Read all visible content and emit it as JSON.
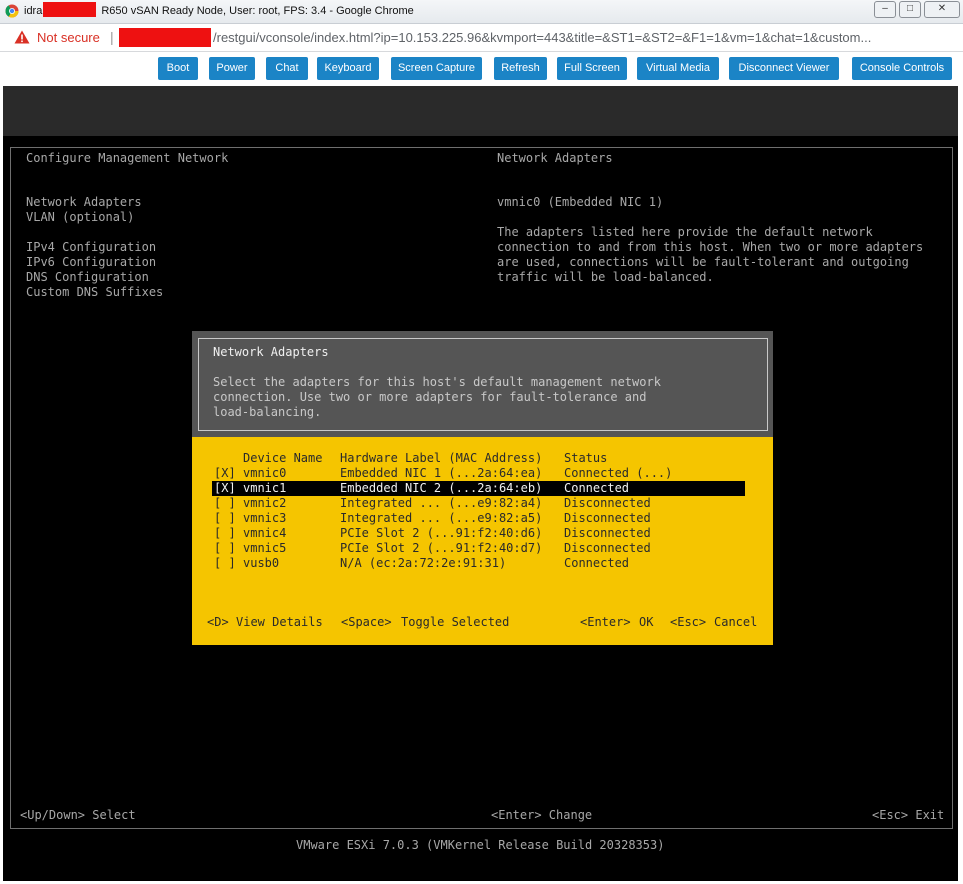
{
  "window": {
    "title_prefix": "idra",
    "title_rest": "R650 vSAN Ready Node, User: root, FPS: 3.4 - Google Chrome",
    "controls": [
      "–",
      "□",
      "✕"
    ]
  },
  "addressbar": {
    "security_label": "Not secure",
    "url": "/restgui/vconsole/index.html?ip=10.153.225.96&kvmport=443&title=&ST1=&ST2=&F1=1&vm=1&chat=1&custom..."
  },
  "toolbar": {
    "buttons": [
      "Boot",
      "Power",
      "Chat",
      "Keyboard",
      "Screen Capture",
      "Refresh",
      "Full Screen",
      "Virtual Media",
      "Disconnect Viewer",
      "Console Controls"
    ]
  },
  "dcui": {
    "left_title": "Configure Management Network",
    "right_title": "Network Adapters",
    "menu": [
      "Network Adapters",
      "VLAN (optional)",
      "IPv4 Configuration",
      "IPv6 Configuration",
      "DNS Configuration",
      "Custom DNS Suffixes"
    ],
    "selected_adapter": "vmnic0 (Embedded NIC 1)",
    "description": [
      "The adapters listed here provide the default network",
      "connection to and from this host. When two or more adapters",
      "are used, connections will be fault-tolerant and outgoing",
      "traffic will be load-balanced."
    ],
    "footer_left": "<Up/Down> Select",
    "footer_center": "<Enter> Change",
    "footer_right": "<Esc> Exit",
    "version": "VMware ESXi 7.0.3 (VMKernel Release Build 20328353)"
  },
  "dialog": {
    "title": "Network Adapters",
    "intro": [
      "Select the adapters for this host's default management network",
      "connection. Use two or more adapters for fault-tolerance and",
      "load-balancing."
    ],
    "columns": {
      "device": "Device Name",
      "hardware": "Hardware Label (MAC Address)",
      "status": "Status"
    },
    "rows": [
      {
        "check": "[X]",
        "device": "vmnic0",
        "hardware": "Embedded NIC 1 (...2a:64:ea)",
        "status": "Connected (...)"
      },
      {
        "check": "[X]",
        "device": "vmnic1",
        "hardware": "Embedded NIC 2 (...2a:64:eb)",
        "status": "Connected"
      },
      {
        "check": "[ ]",
        "device": "vmnic2",
        "hardware": "Integrated ... (...e9:82:a4)",
        "status": "Disconnected"
      },
      {
        "check": "[ ]",
        "device": "vmnic3",
        "hardware": "Integrated ... (...e9:82:a5)",
        "status": "Disconnected"
      },
      {
        "check": "[ ]",
        "device": "vmnic4",
        "hardware": "PCIe Slot 2 (...91:f2:40:d6)",
        "status": "Disconnected"
      },
      {
        "check": "[ ]",
        "device": "vmnic5",
        "hardware": "PCIe Slot 2 (...91:f2:40:d7)",
        "status": "Disconnected"
      },
      {
        "check": "[ ]",
        "device": "vusb0",
        "hardware": "N/A (ec:2a:72:2e:91:31)",
        "status": "Connected"
      }
    ],
    "actions": {
      "details_key": "<D>",
      "details_label": "View Details",
      "toggle_key": "<Space>",
      "toggle_label": "Toggle Selected",
      "ok_key": "<Enter>",
      "ok_label": "OK",
      "cancel_key": "<Esc>",
      "cancel_label": "Cancel"
    }
  }
}
